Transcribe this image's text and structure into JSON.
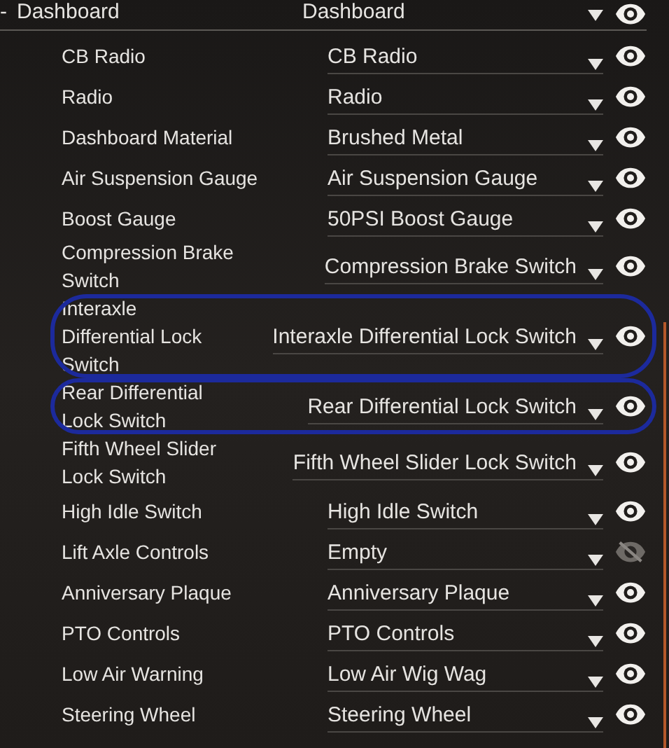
{
  "group": {
    "toggle": "-",
    "label": "Dashboard",
    "value": "Dashboard",
    "visible": true
  },
  "rows": [
    {
      "label": "CB Radio",
      "value": "CB Radio",
      "visible": true,
      "circled": false
    },
    {
      "label": "Radio",
      "value": "Radio",
      "visible": true,
      "circled": false
    },
    {
      "label": "Dashboard Material",
      "value": "Brushed Metal",
      "visible": true,
      "circled": false
    },
    {
      "label": "Air Suspension Gauge",
      "value": "Air Suspension Gauge",
      "visible": true,
      "circled": false
    },
    {
      "label": "Boost Gauge",
      "value": "50PSI Boost Gauge",
      "visible": true,
      "circled": false
    },
    {
      "label": "Compression Brake Switch",
      "value": "Compression Brake Switch",
      "visible": true,
      "circled": false
    },
    {
      "label": "Interaxle Differential Lock Switch",
      "value": "Interaxle Differential Lock Switch",
      "visible": true,
      "circled": true
    },
    {
      "label": "Rear Differential Lock Switch",
      "value": "Rear Differential Lock Switch",
      "visible": true,
      "circled": true
    },
    {
      "label": "Fifth Wheel Slider Lock Switch",
      "value": "Fifth Wheel Slider Lock Switch",
      "visible": true,
      "circled": false
    },
    {
      "label": "High Idle Switch",
      "value": "High Idle Switch",
      "visible": true,
      "circled": false
    },
    {
      "label": "Lift Axle Controls",
      "value": "Empty",
      "visible": false,
      "circled": false
    },
    {
      "label": "Anniversary Plaque",
      "value": "Anniversary Plaque",
      "visible": true,
      "circled": false
    },
    {
      "label": "PTO Controls",
      "value": "PTO Controls",
      "visible": true,
      "circled": false
    },
    {
      "label": "Low Air Warning",
      "value": "Low Air Wig Wag",
      "visible": true,
      "circled": false
    },
    {
      "label": "Steering Wheel",
      "value": "Steering Wheel",
      "visible": true,
      "circled": false
    }
  ]
}
